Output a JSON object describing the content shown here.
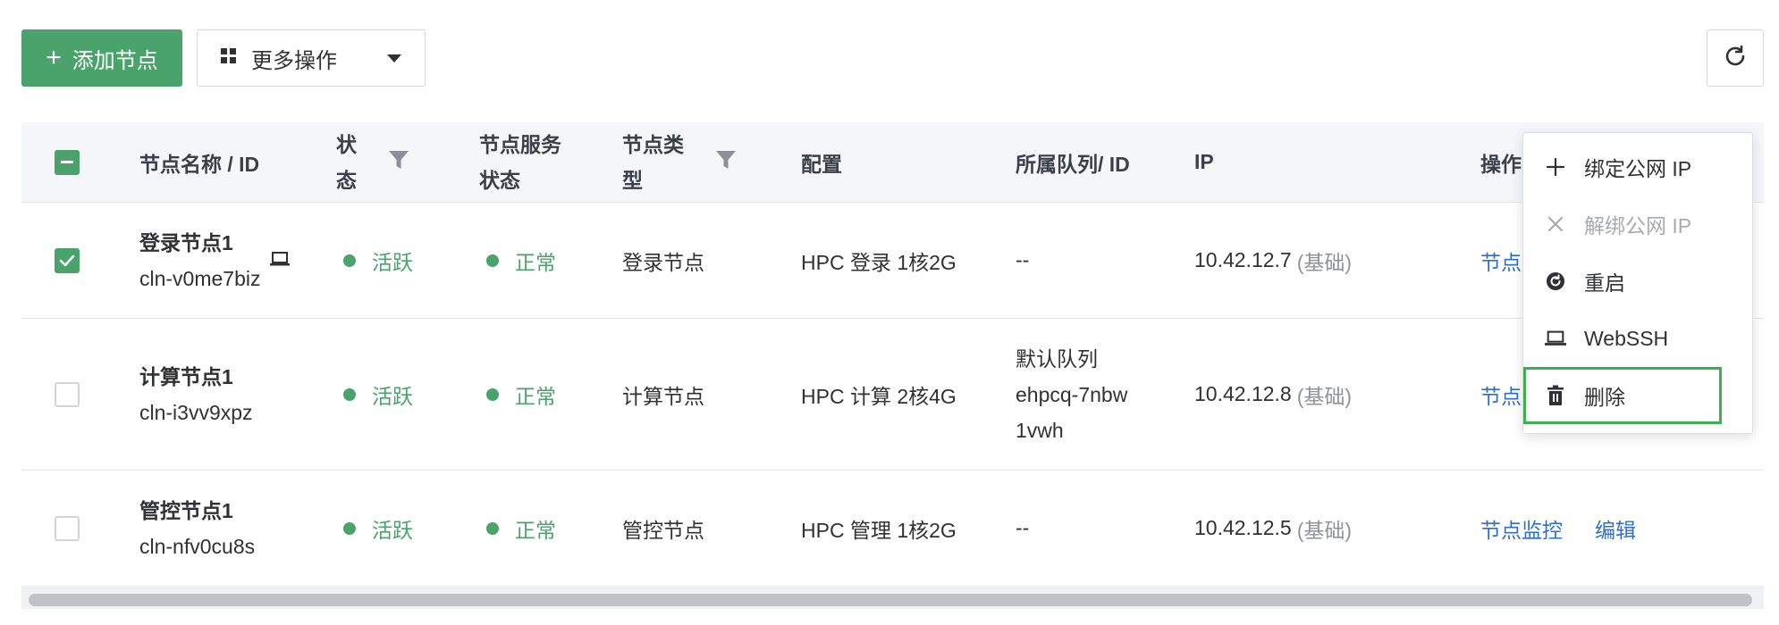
{
  "toolbar": {
    "add_label": "添加节点",
    "more_label": "更多操作"
  },
  "columns": {
    "name": "节点名称 / ID",
    "status_l1": "状",
    "status_l2": "态",
    "svc_l1": "节点服务",
    "svc_l2": "状态",
    "type_l1": "节点类",
    "type_l2": "型",
    "config": "配置",
    "queue": "所属队列/ ID",
    "ip": "IP",
    "ops": "操作"
  },
  "rows": [
    {
      "checked": true,
      "name": "登录节点1",
      "id": "cln-v0me7biz",
      "status": "活跃",
      "service_status": "正常",
      "type": "登录节点",
      "config": "HPC 登录 1核2G",
      "queue": "--",
      "ip": "10.42.12.7",
      "ip_tag": "(基础)",
      "op_monitor": "节点"
    },
    {
      "checked": false,
      "name": "计算节点1",
      "id": "cln-i3vv9xpz",
      "status": "活跃",
      "service_status": "正常",
      "type": "计算节点",
      "config": "HPC 计算 2核4G",
      "queue_l1": "默认队列",
      "queue_l2": "ehpcq-7nbw",
      "queue_l3": "1vwh",
      "ip": "10.42.12.8",
      "ip_tag": "(基础)",
      "op_monitor": "节点"
    },
    {
      "checked": false,
      "name": "管控节点1",
      "id": "cln-nfv0cu8s",
      "status": "活跃",
      "service_status": "正常",
      "type": "管控节点",
      "config": "HPC 管理 1核2G",
      "queue": "--",
      "ip": "10.42.12.5",
      "ip_tag": "(基础)",
      "op_monitor": "节点监控",
      "op_edit": "编辑"
    }
  ],
  "menu": {
    "items": [
      {
        "label": "绑定公网 IP",
        "icon": "plus-icon",
        "disabled": false
      },
      {
        "label": "解绑公网 IP",
        "icon": "close-icon",
        "disabled": true
      },
      {
        "label": "重启",
        "icon": "restart-icon",
        "disabled": false
      },
      {
        "label": "WebSSH",
        "icon": "laptop-icon",
        "disabled": false
      },
      {
        "label": "删除",
        "icon": "trash-icon",
        "disabled": false,
        "highlighted": true
      }
    ]
  },
  "colors": {
    "primary": "#4aa36b",
    "link": "#2c6fd1",
    "highlight_border": "#3fb050"
  }
}
